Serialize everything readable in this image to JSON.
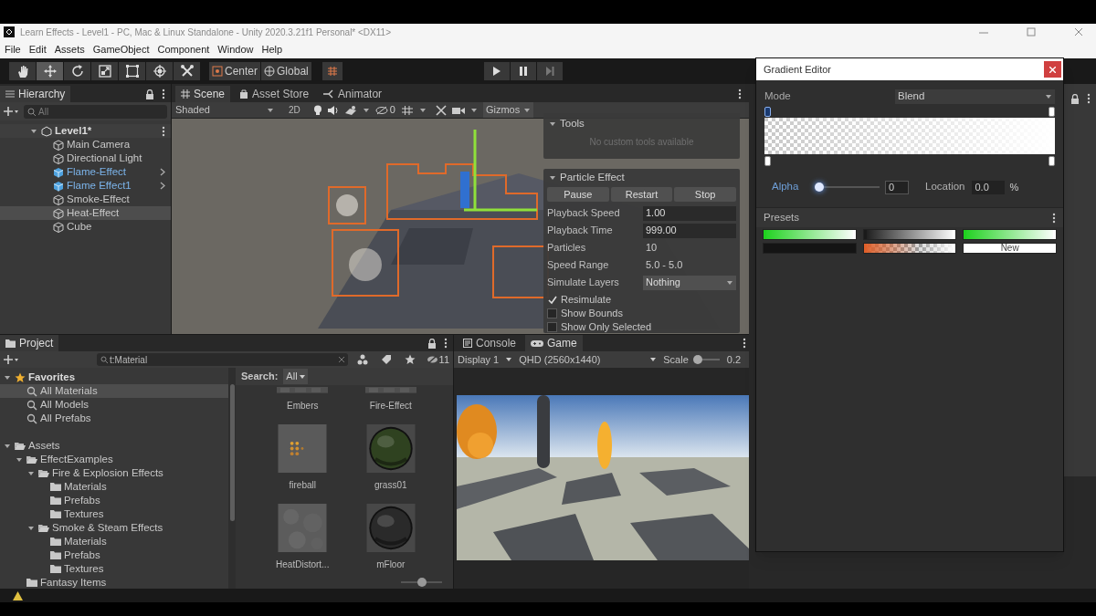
{
  "window": {
    "title": "Learn Effects - Level1 - PC, Mac & Linux Standalone - Unity 2020.3.21f1 Personal* <DX11>"
  },
  "menu": [
    "File",
    "Edit",
    "Assets",
    "GameObject",
    "Component",
    "Window",
    "Help"
  ],
  "toolbar": {
    "tools": [
      {
        "kind": "hand",
        "selected": false
      },
      {
        "kind": "move",
        "selected": true
      },
      {
        "kind": "rotate",
        "selected": false
      },
      {
        "kind": "scale",
        "selected": false
      },
      {
        "kind": "rect",
        "selected": false
      },
      {
        "kind": "transform",
        "selected": false
      },
      {
        "kind": "custom",
        "selected": false
      }
    ],
    "pivot": "Center",
    "space": "Global"
  },
  "hierarchy": {
    "tab": "Hierarchy",
    "search_placeholder": "All",
    "items": [
      {
        "label": "Level1*",
        "kind": "scene",
        "expanded": true,
        "selected": false,
        "children": [
          {
            "label": "Main Camera",
            "kind": "object",
            "selected": false
          },
          {
            "label": "Directional Light",
            "kind": "object",
            "selected": false
          },
          {
            "label": "Flame-Effect",
            "kind": "prefab",
            "selected": false
          },
          {
            "label": "Flame Effect1",
            "kind": "prefab",
            "selected": false
          },
          {
            "label": "Smoke-Effect",
            "kind": "object",
            "selected": false
          },
          {
            "label": "Heat-Effect",
            "kind": "object",
            "selected": true
          },
          {
            "label": "Cube",
            "kind": "object",
            "selected": false
          }
        ]
      }
    ]
  },
  "scene": {
    "tabs": [
      {
        "label": "Scene",
        "kind": "grid",
        "selected": true
      },
      {
        "label": "Asset Store",
        "kind": "bag",
        "selected": false
      },
      {
        "label": "Animator",
        "kind": "flow",
        "selected": false
      }
    ],
    "shading": "Shaded",
    "mode_2d": "2D",
    "hidden_count": "0",
    "gizmos": "Gizmos",
    "tools_overlay": {
      "title": "Tools",
      "message": "No custom tools available"
    },
    "particle_effect": {
      "title": "Particle Effect",
      "buttons": [
        "Pause",
        "Restart",
        "Stop"
      ],
      "fields": [
        {
          "label": "Playback Speed",
          "value": "1.00",
          "kind": "field"
        },
        {
          "label": "Playback Time",
          "value": "999.00",
          "kind": "field"
        },
        {
          "label": "Particles",
          "value": "10",
          "kind": "readout"
        },
        {
          "label": "Speed Range",
          "value": "5.0 - 5.0",
          "kind": "readout"
        },
        {
          "label": "Simulate Layers",
          "value": "Nothing",
          "kind": "dropdown"
        }
      ],
      "options": [
        {
          "label": "Resimulate",
          "checked": true
        },
        {
          "label": "Show Bounds",
          "checked": false
        },
        {
          "label": "Show Only Selected",
          "checked": false
        }
      ]
    }
  },
  "project": {
    "tab": "Project",
    "search": "t:Material",
    "hidden_count": "11",
    "tree": [
      {
        "label": "Favorites",
        "kind": "star",
        "expanded": true,
        "selected": false,
        "children": [
          {
            "label": "All Materials",
            "kind": "search",
            "selected": true
          },
          {
            "label": "All Models",
            "kind": "search",
            "selected": false
          },
          {
            "label": "All Prefabs",
            "kind": "search",
            "selected": false
          }
        ]
      },
      {
        "label": "Assets",
        "kind": "folder",
        "expanded": true,
        "selected": false,
        "children": [
          {
            "label": "EffectExamples",
            "kind": "folder",
            "expanded": true,
            "selected": false,
            "children": [
              {
                "label": "Fire & Explosion Effects",
                "kind": "folder",
                "expanded": true,
                "selected": false,
                "children": [
                  {
                    "label": "Materials",
                    "kind": "folder",
                    "selected": false
                  },
                  {
                    "label": "Prefabs",
                    "kind": "folder",
                    "selected": false
                  },
                  {
                    "label": "Textures",
                    "kind": "folder",
                    "selected": false
                  }
                ]
              },
              {
                "label": "Smoke & Steam Effects",
                "kind": "folder",
                "expanded": true,
                "selected": false,
                "children": [
                  {
                    "label": "Materials",
                    "kind": "folder",
                    "selected": false
                  },
                  {
                    "label": "Prefabs",
                    "kind": "folder",
                    "selected": false
                  },
                  {
                    "label": "Textures",
                    "kind": "folder",
                    "selected": false
                  }
                ]
              }
            ]
          },
          {
            "label": "Fantasy Items",
            "kind": "folder",
            "selected": false
          }
        ]
      }
    ],
    "search_label": "Search:",
    "search_scope": "All",
    "assets": [
      {
        "label": "Embers",
        "kind": "clipped"
      },
      {
        "label": "Fire-Effect",
        "kind": "clipped"
      },
      {
        "label": "fireball",
        "kind": "sprite"
      },
      {
        "label": "grass01",
        "kind": "sphere",
        "color": "#2f4220"
      },
      {
        "label": "HeatDistort...",
        "kind": "texture"
      },
      {
        "label": "mFloor",
        "kind": "sphere",
        "color": "#2a2a2a"
      }
    ],
    "thumb_size": {
      "level": 0.5
    }
  },
  "game": {
    "tabs": [
      {
        "label": "Console",
        "kind": "console",
        "selected": false
      },
      {
        "label": "Game",
        "kind": "gamepad",
        "selected": true
      }
    ],
    "display": "Display 1",
    "resolution": "QHD (2560x1440)",
    "scale_label": "Scale",
    "scale": {
      "level": 0.1
    },
    "scale_value": "0.2"
  },
  "gradient_editor": {
    "title": "Gradient Editor",
    "mode_label": "Mode",
    "mode": "Blend",
    "alpha_keys": [
      {
        "selected": true
      },
      {
        "selected": false
      }
    ],
    "color_keys": [
      {
        "selected": false
      },
      {
        "selected": false
      }
    ],
    "alpha_label": "Alpha",
    "alpha": {
      "level": 0
    },
    "alpha_value": "0",
    "location_label": "Location",
    "location_value": "0.0",
    "location_unit": "%",
    "presets_title": "Presets",
    "presets": [
      {
        "stops": [
          {
            "color": "#1fd11f"
          },
          {
            "color": "#ffffff"
          }
        ],
        "fade": false
      },
      {
        "stops": [
          {
            "color": "#1a1a1a"
          },
          {
            "color": "#ffffff"
          }
        ],
        "fade": false
      },
      {
        "stops": [
          {
            "color": "#1fd11f"
          },
          {
            "color": "#ffffff"
          }
        ],
        "fade": false
      },
      {
        "color": "#141414"
      },
      {
        "stops": [
          {
            "color": "#e0602a"
          },
          {
            "color": "#ffffff"
          }
        ],
        "fade": true
      },
      {
        "color": "#ffffff",
        "label": "New"
      }
    ]
  }
}
